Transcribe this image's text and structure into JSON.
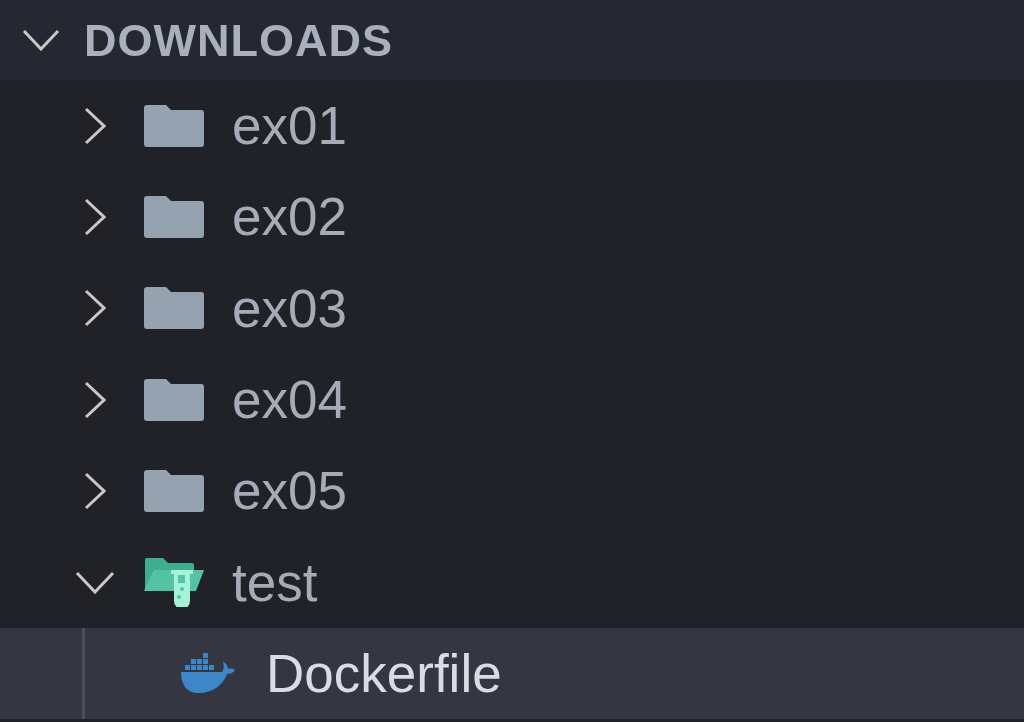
{
  "section": {
    "title": "DOWNLOADS",
    "expanded": true
  },
  "tree": [
    {
      "name": "ex01",
      "kind": "folder",
      "expanded": false,
      "selected": false
    },
    {
      "name": "ex02",
      "kind": "folder",
      "expanded": false,
      "selected": false
    },
    {
      "name": "ex03",
      "kind": "folder",
      "expanded": false,
      "selected": false
    },
    {
      "name": "ex04",
      "kind": "folder",
      "expanded": false,
      "selected": false
    },
    {
      "name": "ex05",
      "kind": "folder",
      "expanded": false,
      "selected": false
    },
    {
      "name": "test",
      "kind": "test-folder",
      "expanded": true,
      "selected": false,
      "children": [
        {
          "name": "Dockerfile",
          "kind": "docker-file",
          "selected": true
        }
      ]
    }
  ]
}
